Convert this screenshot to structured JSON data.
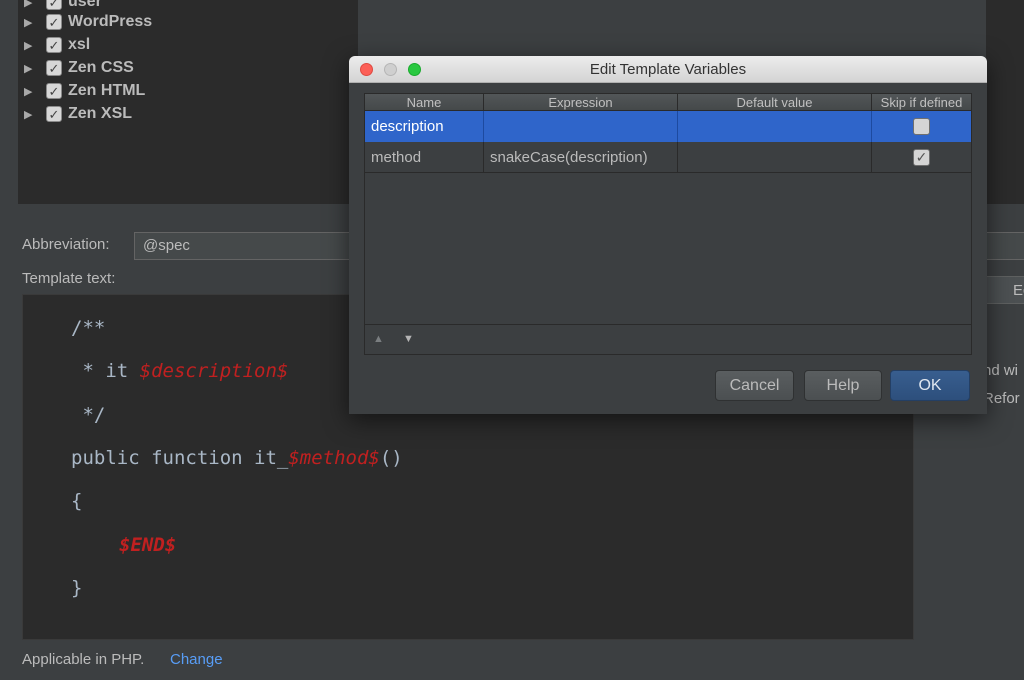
{
  "tree": {
    "items": [
      {
        "label": "user",
        "checked": true
      },
      {
        "label": "WordPress",
        "checked": true
      },
      {
        "label": "xsl",
        "checked": true
      },
      {
        "label": "Zen CSS",
        "checked": true
      },
      {
        "label": "Zen HTML",
        "checked": true
      },
      {
        "label": "Zen XSL",
        "checked": true
      }
    ],
    "arrow_glyph": "▶",
    "check_glyph": "✓"
  },
  "abbreviation": {
    "label": "Abbreviation:",
    "value": "@spec"
  },
  "template_text": {
    "label": "Template text:",
    "lines": {
      "l1": "/**",
      "l2_prefix": " * it ",
      "l2_var": "$description$",
      "l3": " */",
      "l4_prefix": "public function it_",
      "l4_var": "$method$",
      "l4_suffix": "()",
      "l5": "{",
      "l6_var": "$END$",
      "l7": "}"
    }
  },
  "right_side": {
    "edit_label": "Edit",
    "text1": "nd wi",
    "text2": "Refor"
  },
  "footer": {
    "applicable": "Applicable in PHP.",
    "change_link": "Change"
  },
  "dialog": {
    "title": "Edit Template Variables",
    "columns": [
      "Name",
      "Expression",
      "Default value",
      "Skip if defined"
    ],
    "rows": [
      {
        "name": "description",
        "expression": "",
        "default_value": "",
        "skip_if_defined": false
      },
      {
        "name": "method",
        "expression": "snakeCase(description)",
        "default_value": "",
        "skip_if_defined": true
      }
    ],
    "move_up_glyph": "▲",
    "move_down_glyph": "▼",
    "buttons": {
      "cancel": "Cancel",
      "help": "Help",
      "ok": "OK"
    },
    "check_glyph": "✓"
  },
  "colors": {
    "selection": "#2f65ca",
    "code_variable": "#c02020",
    "link": "#589df6",
    "ok_button": "#365880"
  }
}
